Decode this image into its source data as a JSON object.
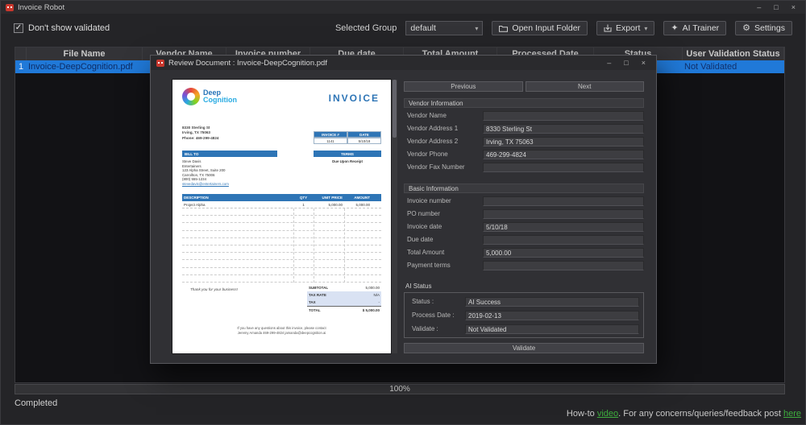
{
  "window": {
    "title": "Invoice Robot"
  },
  "icons": {
    "minimize": "–",
    "maximize": "□",
    "close": "×",
    "caret_down": "▾",
    "check": "✓",
    "gear": "⚙",
    "star": "✦"
  },
  "colors": {
    "selection_blue": "#2079d8",
    "invoice_blue": "#2e75b6",
    "link_green": "#3ead3e",
    "modal_bg": "#303034"
  },
  "toolbar": {
    "dont_show_validated": "Don't show validated",
    "selected_group_label": "Selected Group",
    "selected_group_value": "default",
    "open_input_folder": "Open Input Folder",
    "export_label": "Export",
    "ai_trainer": "AI Trainer",
    "settings": "Settings"
  },
  "table": {
    "columns": [
      "File Name",
      "Vendor Name",
      "Invoice number",
      "Due date",
      "Total Amount",
      "Processed Date",
      "Status",
      "User Validation Status"
    ],
    "row": {
      "num": "1",
      "file_name": "Invoice-DeepCognition.pdf",
      "vendor_name": "",
      "invoice_number": "",
      "due_date": "",
      "total_amount": "",
      "processed_date": "",
      "status": "",
      "user_validation_status": "Not Validated"
    }
  },
  "progress": {
    "percent": "100%"
  },
  "statusbar": {
    "left": "Completed",
    "help_prefix": "How-to",
    "video_link": "video",
    "help_middle": ". For any concerns/queries/feedback post",
    "here_link": "here"
  },
  "modal": {
    "title": "Review Document : Invoice-DeepCognition.pdf",
    "prev_button": "Previous",
    "next_button": "Next",
    "vendor_section": "Vendor Information",
    "vendor_fields": [
      {
        "label": "Vendor Name",
        "value": ""
      },
      {
        "label": "Vendor Address 1",
        "value": "8330 Sterling St"
      },
      {
        "label": "Vendor Address 2",
        "value": "Irving, TX 75063"
      },
      {
        "label": "Vendor Phone",
        "value": "469-299-4824"
      },
      {
        "label": "Vendor Fax Number",
        "value": ""
      }
    ],
    "basic_section": "Basic Information",
    "basic_fields": [
      {
        "label": "Invoice number",
        "value": ""
      },
      {
        "label": "PO number",
        "value": ""
      },
      {
        "label": "Invoice date",
        "value": "5/10/18"
      },
      {
        "label": "Due date",
        "value": ""
      },
      {
        "label": "Total Amount",
        "value": "5,000.00"
      },
      {
        "label": "Payment terms",
        "value": ""
      }
    ],
    "ai_section": "AI Status",
    "ai_fields": [
      {
        "label": "Status :",
        "value": "AI Success"
      },
      {
        "label": "Process Date :",
        "value": "2019-02-13"
      },
      {
        "label": "Validate :",
        "value": "Not Validated"
      }
    ],
    "validate_button": "Validate"
  },
  "invoice": {
    "company_line1": "Deep",
    "company_line2": "Cognition",
    "title": "INVOICE",
    "address_lines": [
      "8330 Sterling St",
      "Irving, TX 75063",
      "Phone: 469-299-4824"
    ],
    "invoice_no_label": "INVOICE #",
    "invoice_no": "1141",
    "date_label": "DATE",
    "date": "5/10/18",
    "bill_to_label": "BILL TO",
    "bill_to_lines": [
      "Steve Davis",
      "Entertainers",
      "123 Alpha Street, Suite 200",
      "Carrollton, TX 75006",
      "(800) 555-1234",
      "stevedavis@entertainers.com"
    ],
    "terms_label": "TERMS",
    "terms_value": "Due Upon Receipt",
    "items_headers": [
      "DESCRIPTION",
      "QTY",
      "UNIT PRICE",
      "AMOUNT"
    ],
    "item": {
      "description": "Project Alpha",
      "qty": "1",
      "unit_price": "5,000.00",
      "amount": "5,000.00"
    },
    "thank_you": "Thank you for your business!",
    "totals": [
      {
        "label": "SUBTOTAL",
        "value": "5,000.00"
      },
      {
        "label": "TAX RATE",
        "value": "N/A"
      },
      {
        "label": "TAX",
        "value": "-"
      },
      {
        "label": "TOTAL",
        "value": "$  5,000.00"
      }
    ],
    "footer_line1": "If you have any questions about this invoice, please contact",
    "footer_line2": "Jeremy Amanda   469-299-4824   jamanda@deepcognition.ai"
  }
}
